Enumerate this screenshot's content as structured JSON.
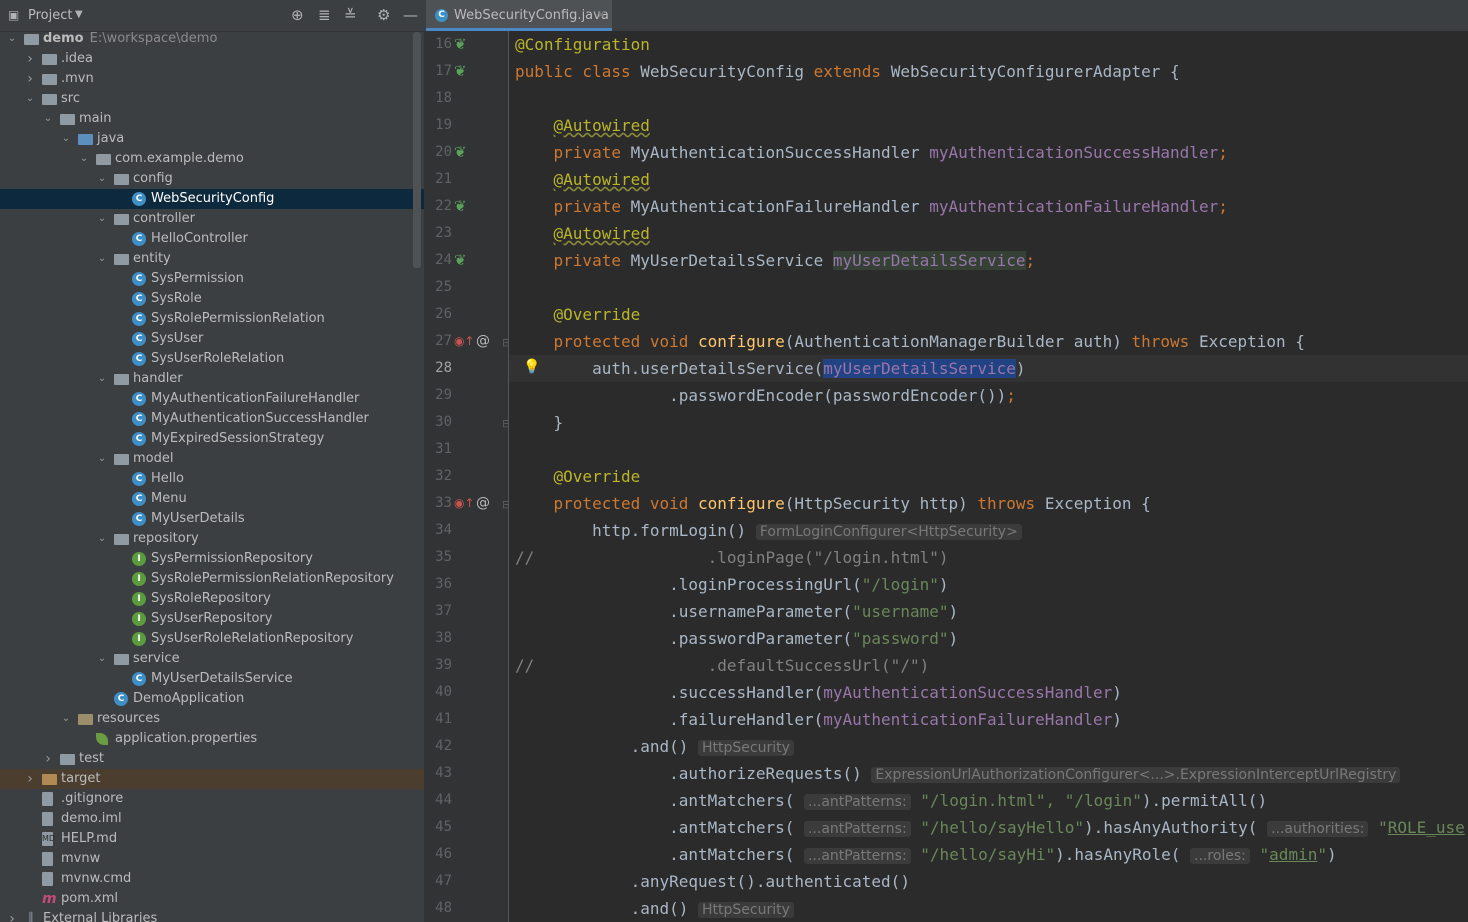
{
  "project_panel": {
    "title": "Project",
    "tree": [
      {
        "label": "demo",
        "path": "E:\\workspace\\demo",
        "depth": 0,
        "icon": "module-folder",
        "arrow": "down"
      },
      {
        "label": ".idea",
        "depth": 1,
        "icon": "folder",
        "arrow": "right"
      },
      {
        "label": ".mvn",
        "depth": 1,
        "icon": "folder",
        "arrow": "right"
      },
      {
        "label": "src",
        "depth": 1,
        "icon": "folder",
        "arrow": "down"
      },
      {
        "label": "main",
        "depth": 2,
        "icon": "folder",
        "arrow": "down"
      },
      {
        "label": "java",
        "depth": 3,
        "icon": "source-folder",
        "arrow": "down"
      },
      {
        "label": "com.example.demo",
        "depth": 4,
        "icon": "package",
        "arrow": "down"
      },
      {
        "label": "config",
        "depth": 5,
        "icon": "package",
        "arrow": "down"
      },
      {
        "label": "WebSecurityConfig",
        "depth": 6,
        "icon": "class",
        "selected": true
      },
      {
        "label": "controller",
        "depth": 5,
        "icon": "package",
        "arrow": "down"
      },
      {
        "label": "HelloController",
        "depth": 6,
        "icon": "class"
      },
      {
        "label": "entity",
        "depth": 5,
        "icon": "package",
        "arrow": "down"
      },
      {
        "label": "SysPermission",
        "depth": 6,
        "icon": "class"
      },
      {
        "label": "SysRole",
        "depth": 6,
        "icon": "class"
      },
      {
        "label": "SysRolePermissionRelation",
        "depth": 6,
        "icon": "class"
      },
      {
        "label": "SysUser",
        "depth": 6,
        "icon": "class"
      },
      {
        "label": "SysUserRoleRelation",
        "depth": 6,
        "icon": "class"
      },
      {
        "label": "handler",
        "depth": 5,
        "icon": "package",
        "arrow": "down"
      },
      {
        "label": "MyAuthenticationFailureHandler",
        "depth": 6,
        "icon": "class"
      },
      {
        "label": "MyAuthenticationSuccessHandler",
        "depth": 6,
        "icon": "class"
      },
      {
        "label": "MyExpiredSessionStrategy",
        "depth": 6,
        "icon": "class"
      },
      {
        "label": "model",
        "depth": 5,
        "icon": "package",
        "arrow": "down"
      },
      {
        "label": "Hello",
        "depth": 6,
        "icon": "class"
      },
      {
        "label": "Menu",
        "depth": 6,
        "icon": "class"
      },
      {
        "label": "MyUserDetails",
        "depth": 6,
        "icon": "class"
      },
      {
        "label": "repository",
        "depth": 5,
        "icon": "package",
        "arrow": "down"
      },
      {
        "label": "SysPermissionRepository",
        "depth": 6,
        "icon": "interface"
      },
      {
        "label": "SysRolePermissionRelationRepository",
        "depth": 6,
        "icon": "interface"
      },
      {
        "label": "SysRoleRepository",
        "depth": 6,
        "icon": "interface"
      },
      {
        "label": "SysUserRepository",
        "depth": 6,
        "icon": "interface"
      },
      {
        "label": "SysUserRoleRelationRepository",
        "depth": 6,
        "icon": "interface"
      },
      {
        "label": "service",
        "depth": 5,
        "icon": "package",
        "arrow": "down"
      },
      {
        "label": "MyUserDetailsService",
        "depth": 6,
        "icon": "class"
      },
      {
        "label": "DemoApplication",
        "depth": 5,
        "icon": "spring-app"
      },
      {
        "label": "resources",
        "depth": 3,
        "icon": "resources-folder",
        "arrow": "down"
      },
      {
        "label": "application.properties",
        "depth": 4,
        "icon": "properties"
      },
      {
        "label": "test",
        "depth": 2,
        "icon": "folder",
        "arrow": "right"
      },
      {
        "label": "target",
        "depth": 1,
        "icon": "excluded-folder",
        "arrow": "right",
        "excluded": true
      },
      {
        "label": ".gitignore",
        "depth": 1,
        "icon": "file"
      },
      {
        "label": "demo.iml",
        "depth": 1,
        "icon": "file"
      },
      {
        "label": "HELP.md",
        "depth": 1,
        "icon": "markdown"
      },
      {
        "label": "mvnw",
        "depth": 1,
        "icon": "file"
      },
      {
        "label": "mvnw.cmd",
        "depth": 1,
        "icon": "file"
      },
      {
        "label": "pom.xml",
        "depth": 1,
        "icon": "maven"
      },
      {
        "label": "External Libraries",
        "depth": 0,
        "icon": "libraries",
        "arrow": "right"
      }
    ]
  },
  "editor": {
    "tab_label": "WebSecurityConfig.java",
    "current_line": 28,
    "lines": [
      {
        "n": 16,
        "icons": [
          "bean-icon"
        ],
        "parts": [
          [
            "ann",
            "@Configuration"
          ]
        ]
      },
      {
        "n": 17,
        "icons": [
          "bean-icon"
        ],
        "parts": [
          [
            "kw",
            "public class "
          ],
          [
            "",
            "WebSecurityConfig "
          ],
          [
            "kw",
            "extends "
          ],
          [
            "",
            "WebSecurityConfigurerAdapter {"
          ]
        ]
      },
      {
        "n": 18,
        "parts": []
      },
      {
        "n": 19,
        "parts": [
          [
            "",
            "    "
          ],
          [
            "ann-u",
            "@Autowired"
          ]
        ]
      },
      {
        "n": 20,
        "icons": [
          "bean-icon"
        ],
        "parts": [
          [
            "kw",
            "    private "
          ],
          [
            "",
            "MyAuthenticationSuccessHandler "
          ],
          [
            "fld",
            "myAuthenticationSuccessHandler"
          ],
          [
            "kw",
            ";"
          ]
        ]
      },
      {
        "n": 21,
        "parts": [
          [
            "",
            "    "
          ],
          [
            "ann-u",
            "@Autowired"
          ]
        ]
      },
      {
        "n": 22,
        "icons": [
          "bean-icon"
        ],
        "parts": [
          [
            "kw",
            "    private "
          ],
          [
            "",
            "MyAuthenticationFailureHandler "
          ],
          [
            "fld",
            "myAuthenticationFailureHandler"
          ],
          [
            "kw",
            ";"
          ]
        ]
      },
      {
        "n": 23,
        "parts": [
          [
            "",
            "    "
          ],
          [
            "ann-u",
            "@Autowired"
          ]
        ]
      },
      {
        "n": 24,
        "icons": [
          "bean-icon"
        ],
        "parts": [
          [
            "kw",
            "    private "
          ],
          [
            "",
            "MyUserDetailsService "
          ],
          [
            "fld occ",
            "myUserDetailsService"
          ],
          [
            "kw",
            ";"
          ]
        ]
      },
      {
        "n": 25,
        "parts": []
      },
      {
        "n": 26,
        "parts": [
          [
            "ann",
            "    @Override"
          ]
        ]
      },
      {
        "n": 27,
        "icons": [
          "override-icon",
          "at-icon"
        ],
        "fold": true,
        "parts": [
          [
            "kw",
            "    protected void "
          ],
          [
            "fn",
            "configure"
          ],
          [
            "",
            "(AuthenticationManagerBuilder auth) "
          ],
          [
            "kw",
            "throws "
          ],
          [
            "",
            "Exception {"
          ]
        ]
      },
      {
        "n": 28,
        "bulb": true,
        "parts": [
          [
            "",
            "        auth.userDetailsService("
          ],
          [
            "fld sel-word",
            "myUserDetailsService"
          ],
          [
            "",
            ")"
          ]
        ]
      },
      {
        "n": 29,
        "parts": [
          [
            "",
            "                .passwordEncoder(passwordEncoder())"
          ],
          [
            "kw",
            ";"
          ]
        ]
      },
      {
        "n": 30,
        "fold": true,
        "parts": [
          [
            "",
            "    }"
          ]
        ]
      },
      {
        "n": 31,
        "parts": []
      },
      {
        "n": 32,
        "parts": [
          [
            "ann",
            "    @Override"
          ]
        ]
      },
      {
        "n": 33,
        "icons": [
          "override-icon",
          "at-icon"
        ],
        "fold": true,
        "parts": [
          [
            "kw",
            "    protected void "
          ],
          [
            "fn",
            "configure"
          ],
          [
            "",
            "(HttpSecurity http) "
          ],
          [
            "kw",
            "throws "
          ],
          [
            "",
            "Exception {"
          ]
        ]
      },
      {
        "n": 34,
        "parts": [
          [
            "",
            "        http.formLogin() "
          ],
          [
            "hint",
            "FormLoginConfigurer<HttpSecurity>"
          ]
        ]
      },
      {
        "n": 35,
        "parts": [
          [
            "cmt",
            "//                  .loginPage(\"/login.html\")"
          ]
        ]
      },
      {
        "n": 36,
        "parts": [
          [
            "",
            "                .loginProcessingUrl("
          ],
          [
            "str",
            "\"/login\""
          ],
          [
            "",
            ")"
          ]
        ]
      },
      {
        "n": 37,
        "parts": [
          [
            "",
            "                .usernameParameter("
          ],
          [
            "str",
            "\"username\""
          ],
          [
            "",
            ")"
          ]
        ]
      },
      {
        "n": 38,
        "parts": [
          [
            "",
            "                .passwordParameter("
          ],
          [
            "str",
            "\"password\""
          ],
          [
            "",
            ")"
          ]
        ]
      },
      {
        "n": 39,
        "parts": [
          [
            "cmt",
            "//                  .defaultSuccessUrl(\"/\")"
          ]
        ]
      },
      {
        "n": 40,
        "parts": [
          [
            "",
            "                .successHandler("
          ],
          [
            "fld",
            "myAuthenticationSuccessHandler"
          ],
          [
            "",
            ")"
          ]
        ]
      },
      {
        "n": 41,
        "parts": [
          [
            "",
            "                .failureHandler("
          ],
          [
            "fld",
            "myAuthenticationFailureHandler"
          ],
          [
            "",
            ")"
          ]
        ]
      },
      {
        "n": 42,
        "parts": [
          [
            "",
            "            .and() "
          ],
          [
            "hint",
            "HttpSecurity"
          ]
        ]
      },
      {
        "n": 43,
        "parts": [
          [
            "",
            "                .authorizeRequests() "
          ],
          [
            "hint",
            "ExpressionUrlAuthorizationConfigurer<...>.ExpressionInterceptUrlRegistry"
          ]
        ]
      },
      {
        "n": 44,
        "parts": [
          [
            "",
            "                .antMatchers( "
          ],
          [
            "hint",
            "...antPatterns:"
          ],
          [
            "str",
            " \"/login.html\", \"/login\""
          ],
          [
            "",
            ").permitAll()"
          ]
        ]
      },
      {
        "n": 45,
        "parts": [
          [
            "",
            "                .antMatchers( "
          ],
          [
            "hint",
            "...antPatterns:"
          ],
          [
            "str",
            " \"/hello/sayHello\""
          ],
          [
            "",
            ").hasAnyAuthority( "
          ],
          [
            "hint",
            "...authorities:"
          ],
          [
            "str",
            " \""
          ],
          [
            "str link",
            "ROLE_use"
          ]
        ]
      },
      {
        "n": 46,
        "parts": [
          [
            "",
            "                .antMatchers( "
          ],
          [
            "hint",
            "...antPatterns:"
          ],
          [
            "str",
            " \"/hello/sayHi\""
          ],
          [
            "",
            ").hasAnyRole( "
          ],
          [
            "hint",
            "...roles:"
          ],
          [
            "str",
            " \""
          ],
          [
            "str link",
            "admin"
          ],
          [
            "str",
            "\""
          ],
          [
            "",
            ")"
          ]
        ]
      },
      {
        "n": 47,
        "parts": [
          [
            "",
            "            .anyRequest().authenticated()"
          ]
        ]
      },
      {
        "n": 48,
        "parts": [
          [
            "",
            "            .and() "
          ],
          [
            "hint",
            "HttpSecurity"
          ]
        ]
      }
    ]
  }
}
